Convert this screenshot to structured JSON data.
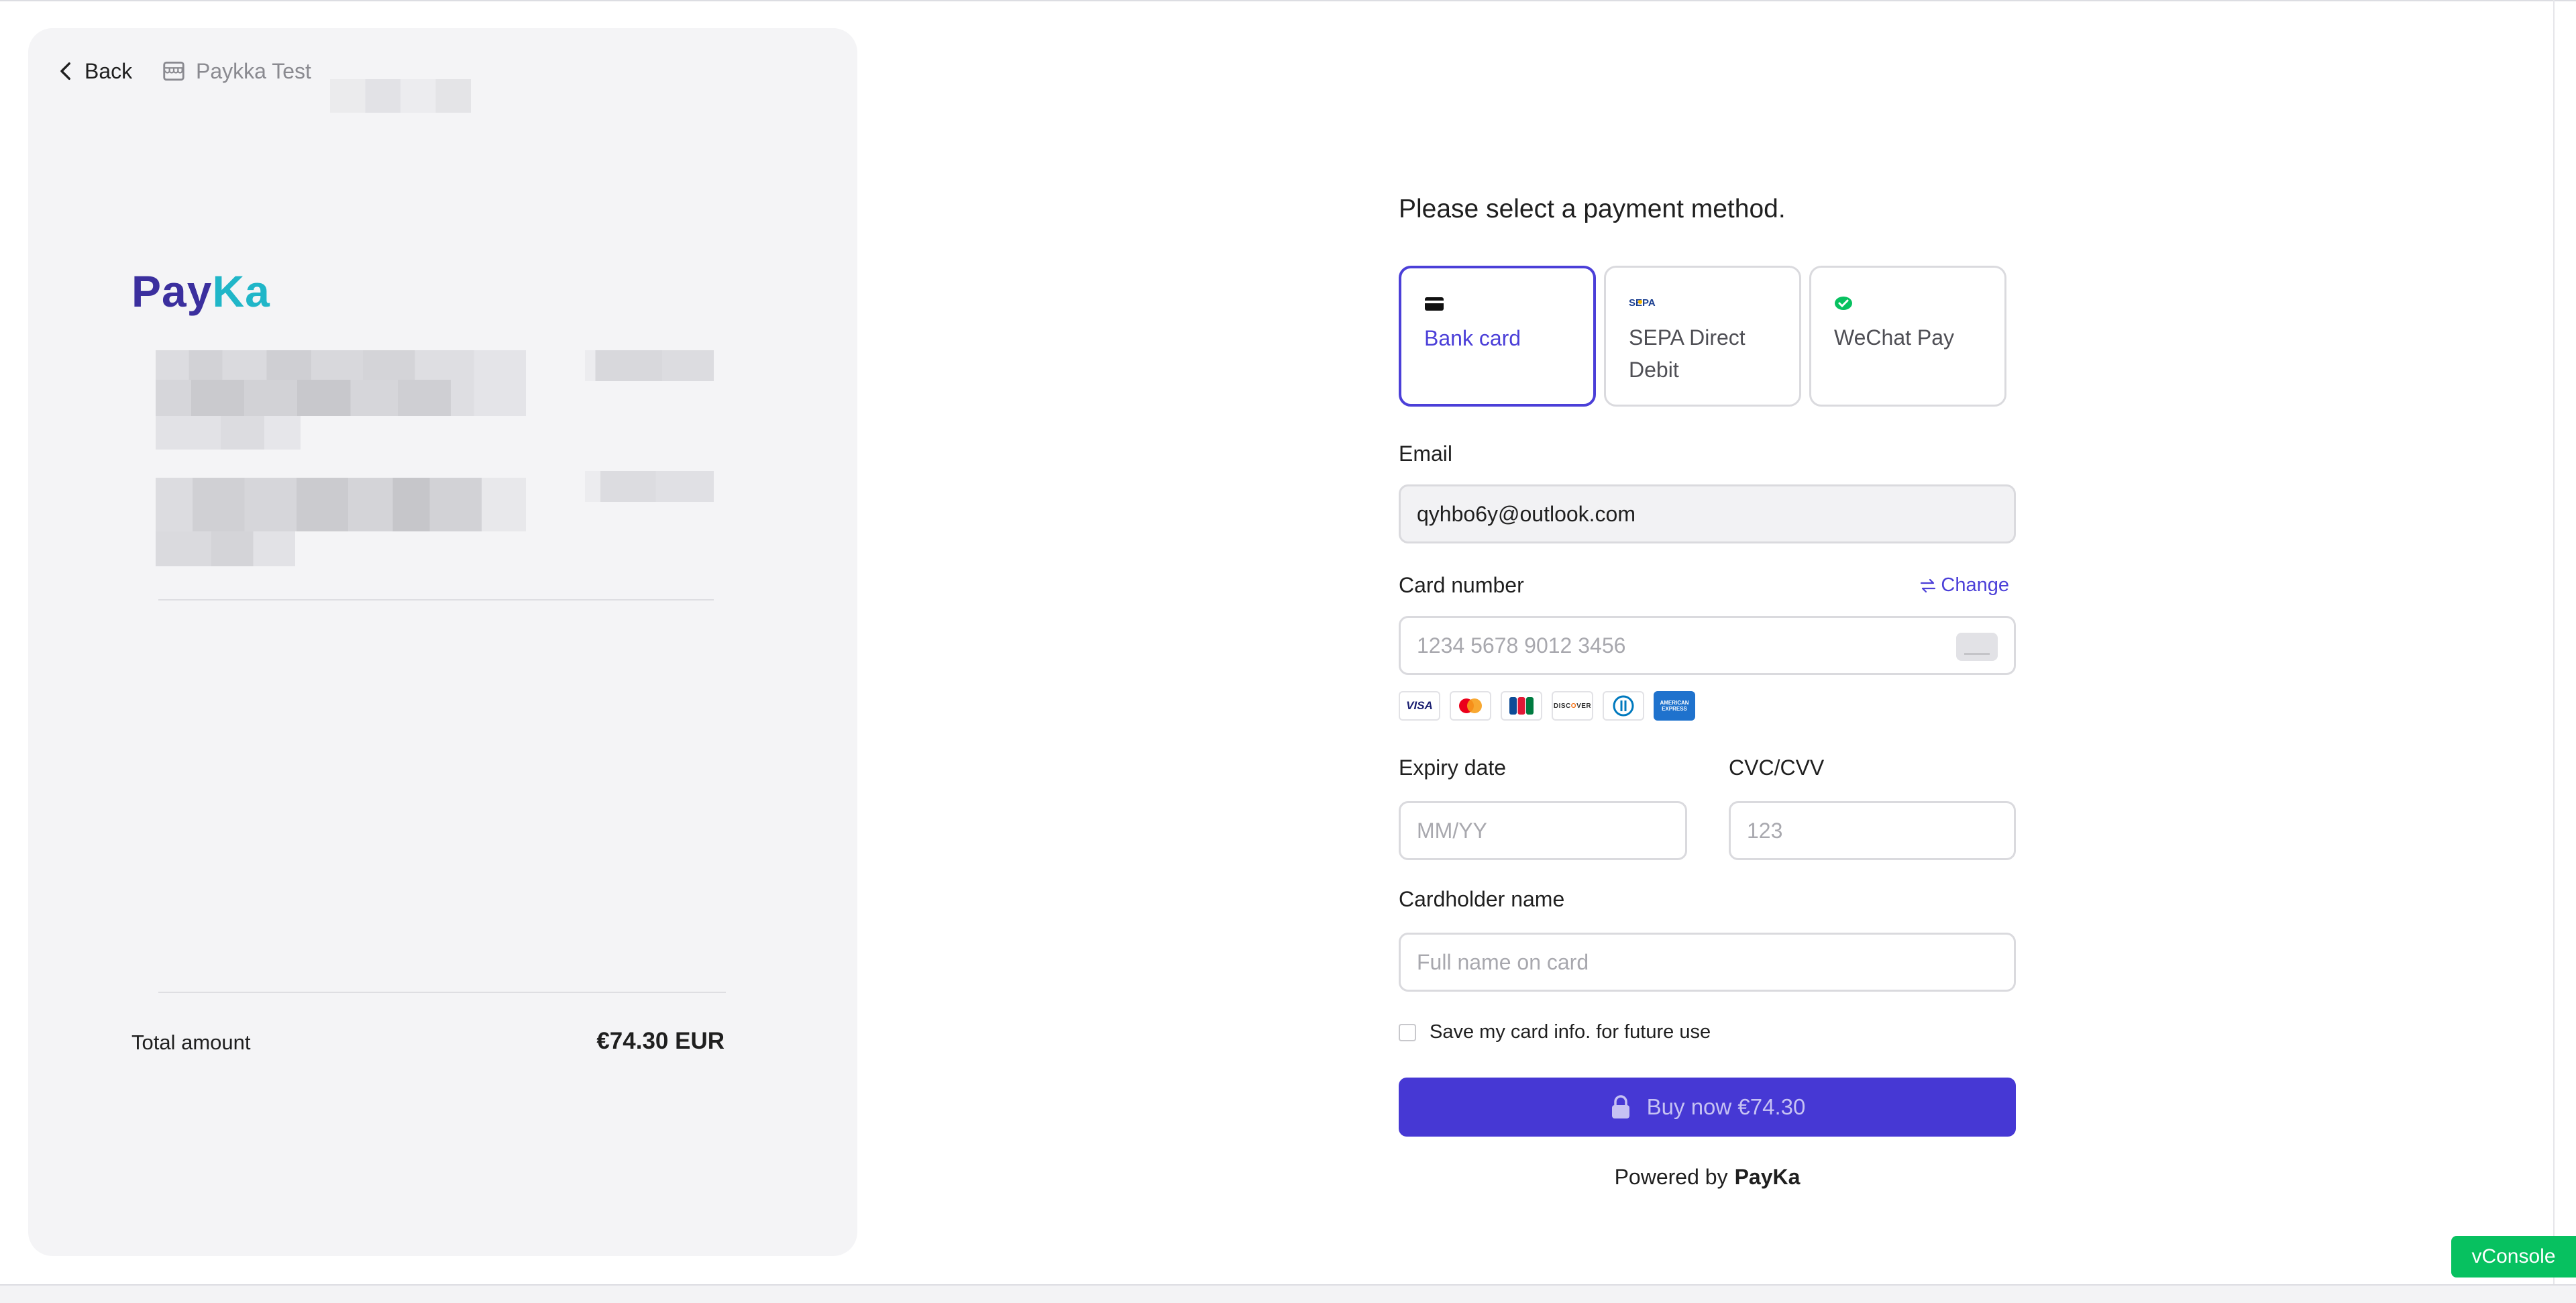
{
  "colors": {
    "accent": "#4b3fd8",
    "buy_button": "#4638d4",
    "panel_bg": "#f4f4f6",
    "vconsole": "#07c160",
    "logo_primary": "#3b2f9e",
    "logo_secondary": "#20b6c8"
  },
  "nav": {
    "back_label": "Back",
    "store_name": "Paykka Test"
  },
  "logo": {
    "text_a": "Pay",
    "text_b": "Ka"
  },
  "summary": {
    "total_label": "Total amount",
    "total_value": "€74.30 EUR"
  },
  "payment": {
    "heading": "Please select a payment method.",
    "methods": [
      {
        "label": "Bank card",
        "icon": "card-icon",
        "selected": true
      },
      {
        "label": "SEPA Direct Debit",
        "icon": "sepa-icon",
        "selected": false
      },
      {
        "label": "WeChat Pay",
        "icon": "wechat-icon",
        "selected": false
      }
    ],
    "email_label": "Email",
    "email_value": "qyhbo6y@outlook.com",
    "card_label": "Card number",
    "change_label": "Change",
    "card_placeholder": "1234 5678 9012 3456",
    "brands": [
      "VISA",
      "Mastercard",
      "JCB",
      "Discover",
      "Diners Club",
      "American Express"
    ],
    "expiry_label": "Expiry date",
    "expiry_placeholder": "MM/YY",
    "cvc_label": "CVC/CVV",
    "cvc_placeholder": "123",
    "holder_label": "Cardholder name",
    "holder_placeholder": "Full name on card",
    "save_label": "Save my card info. for future use",
    "buy_label": "Buy now €74.30",
    "powered_label": "Powered by",
    "powered_brand": "PayKa"
  },
  "vconsole_label": "vConsole"
}
